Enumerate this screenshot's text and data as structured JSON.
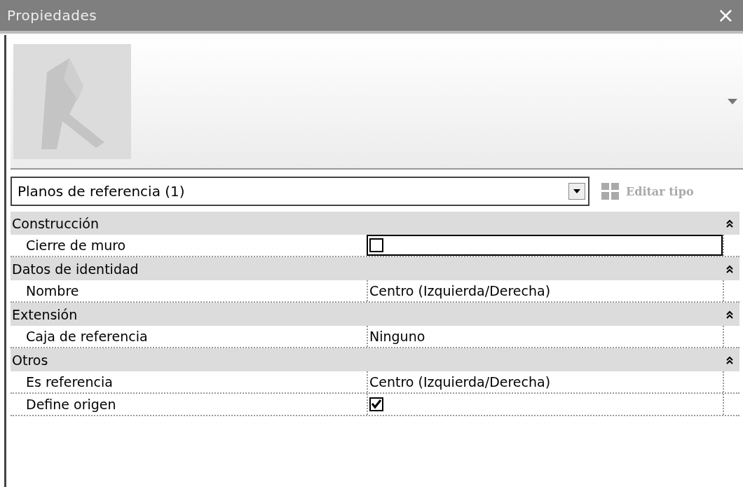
{
  "window": {
    "title": "Propiedades",
    "close": "×"
  },
  "type_selector": {
    "value": "Planos de referencia (1)"
  },
  "edit_type_button": {
    "label": "Editar tipo",
    "disabled": true
  },
  "sections": [
    {
      "name": "Construcción",
      "expanded": true,
      "rows": [
        {
          "kind": "checkbox",
          "label": "Cierre de muro",
          "checked": false,
          "selected": true
        }
      ]
    },
    {
      "name": "Datos de identidad",
      "expanded": true,
      "rows": [
        {
          "kind": "text",
          "label": "Nombre",
          "value": "Centro (Izquierda/Derecha)",
          "selected": false
        }
      ]
    },
    {
      "name": "Extensión",
      "expanded": true,
      "rows": [
        {
          "kind": "text",
          "label": "Caja de referencia",
          "value": "Ninguno",
          "selected": false
        }
      ]
    },
    {
      "name": "Otros",
      "expanded": true,
      "rows": [
        {
          "kind": "text",
          "label": "Es referencia",
          "value": "Centro (Izquierda/Derecha)",
          "selected": false
        },
        {
          "kind": "checkbox",
          "label": "Define origen",
          "checked": true,
          "selected": false
        }
      ]
    }
  ]
}
